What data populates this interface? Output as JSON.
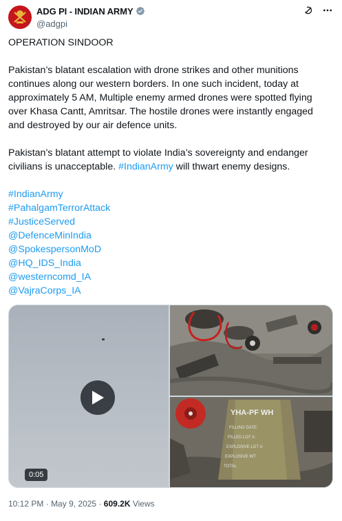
{
  "author": {
    "display_name": "ADG PI - INDIAN ARMY",
    "handle": "@adgpi",
    "avatar_color": "#c4161c",
    "verified_color": "#829aab"
  },
  "top_actions": {
    "grok_icon": "grok-icon",
    "more_icon": "more-icon"
  },
  "tweet": {
    "heading": "OPERATION SINDOOR",
    "paragraph_1": "Pakistan’s blatant escalation with drone strikes and other munitions continues along our western borders. In one such incident, today at approximately 5 AM, Multiple enemy armed drones were spotted flying over Khasa Cantt, Amritsar. The hostile drones were instantly engaged and destroyed by our air defence units.",
    "paragraph_2_text": "Pakistan’s blatant attempt to violate India’s sovereignty and endanger civilians is unacceptable.",
    "paragraph_2_link": "#IndianArmy",
    "paragraph_2_tail": "will thwart enemy designs.",
    "tags": [
      "#IndianArmy",
      "#PahalgamTerrorAttack",
      "#JusticeServed",
      "@DefenceMinIndia",
      "@SpokespersonMoD",
      "@HQ_IDS_India",
      "@westerncomd_IA",
      "@VajraCorps_IA"
    ],
    "link_color": "#1d9bf0"
  },
  "media": {
    "video_duration": "0:05",
    "photo_2_text": {
      "line_1": "YHA-PF WH",
      "line_2": "FILLING DATE:",
      "line_3": "FILLED LOT #:",
      "line_4": "EXPLOSIVE LOT #:",
      "line_5": "EXPLOSIVE WT:",
      "line_6": "TOTAL"
    }
  },
  "meta": {
    "time": "10:12 PM",
    "separator": "·",
    "date": "May 9, 2025",
    "views_count": "609.2K",
    "views_label": "Views"
  }
}
